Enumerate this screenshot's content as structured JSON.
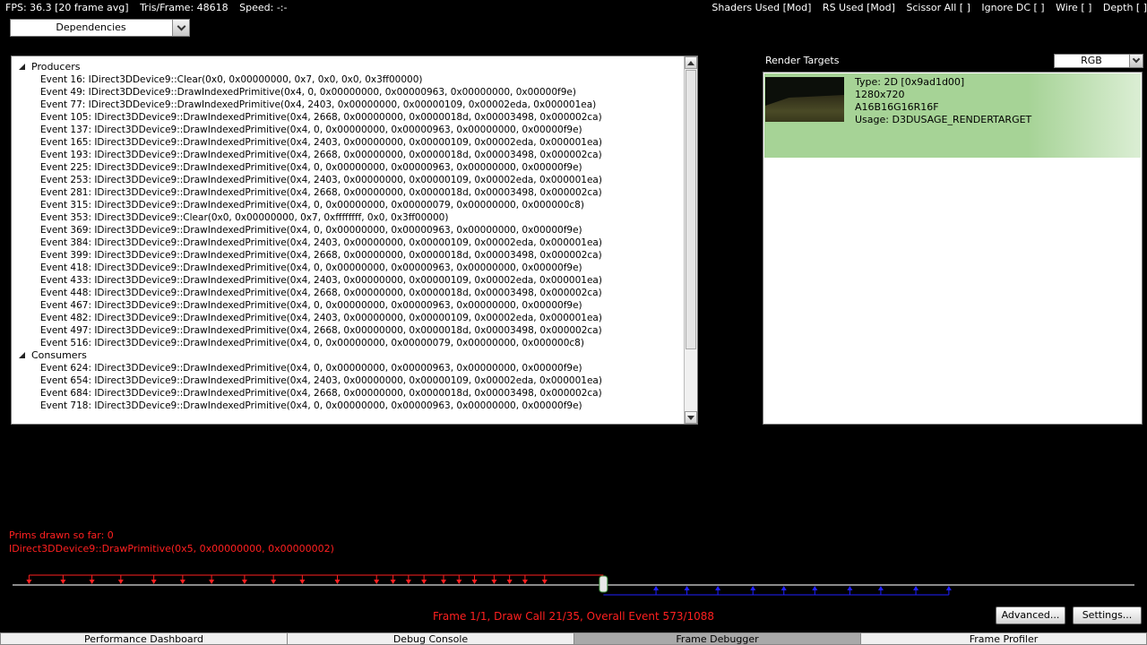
{
  "hud": {
    "fps": "FPS: 36.3 [20 frame avg]",
    "tris": "Tris/Frame:  48618",
    "speed": "Speed:  -:-",
    "toggles": [
      "Shaders Used [Mod]",
      "RS Used [Mod]",
      "Scissor All [ ]",
      "Ignore DC [ ]",
      "Wire [ ]",
      "Depth [ ]"
    ]
  },
  "view_selector": {
    "selected": "Dependencies"
  },
  "dependencies": {
    "producers_label": "Producers",
    "producers": [
      "Event 16: IDirect3DDevice9::Clear(0x0, 0x00000000, 0x7, 0x0, 0x0, 0x3ff00000)",
      "Event 49: IDirect3DDevice9::DrawIndexedPrimitive(0x4, 0, 0x00000000, 0x00000963, 0x00000000, 0x00000f9e)",
      "Event 77: IDirect3DDevice9::DrawIndexedPrimitive(0x4, 2403, 0x00000000, 0x00000109, 0x00002eda, 0x000001ea)",
      "Event 105: IDirect3DDevice9::DrawIndexedPrimitive(0x4, 2668, 0x00000000, 0x0000018d, 0x00003498, 0x000002ca)",
      "Event 137: IDirect3DDevice9::DrawIndexedPrimitive(0x4, 0, 0x00000000, 0x00000963, 0x00000000, 0x00000f9e)",
      "Event 165: IDirect3DDevice9::DrawIndexedPrimitive(0x4, 2403, 0x00000000, 0x00000109, 0x00002eda, 0x000001ea)",
      "Event 193: IDirect3DDevice9::DrawIndexedPrimitive(0x4, 2668, 0x00000000, 0x0000018d, 0x00003498, 0x000002ca)",
      "Event 225: IDirect3DDevice9::DrawIndexedPrimitive(0x4, 0, 0x00000000, 0x00000963, 0x00000000, 0x00000f9e)",
      "Event 253: IDirect3DDevice9::DrawIndexedPrimitive(0x4, 2403, 0x00000000, 0x00000109, 0x00002eda, 0x000001ea)",
      "Event 281: IDirect3DDevice9::DrawIndexedPrimitive(0x4, 2668, 0x00000000, 0x0000018d, 0x00003498, 0x000002ca)",
      "Event 315: IDirect3DDevice9::DrawIndexedPrimitive(0x4, 0, 0x00000000, 0x00000079, 0x00000000, 0x000000c8)",
      "Event 353: IDirect3DDevice9::Clear(0x0, 0x00000000, 0x7, 0xffffffff, 0x0, 0x3ff00000)",
      "Event 369: IDirect3DDevice9::DrawIndexedPrimitive(0x4, 0, 0x00000000, 0x00000963, 0x00000000, 0x00000f9e)",
      "Event 384: IDirect3DDevice9::DrawIndexedPrimitive(0x4, 2403, 0x00000000, 0x00000109, 0x00002eda, 0x000001ea)",
      "Event 399: IDirect3DDevice9::DrawIndexedPrimitive(0x4, 2668, 0x00000000, 0x0000018d, 0x00003498, 0x000002ca)",
      "Event 418: IDirect3DDevice9::DrawIndexedPrimitive(0x4, 0, 0x00000000, 0x00000963, 0x00000000, 0x00000f9e)",
      "Event 433: IDirect3DDevice9::DrawIndexedPrimitive(0x4, 2403, 0x00000000, 0x00000109, 0x00002eda, 0x000001ea)",
      "Event 448: IDirect3DDevice9::DrawIndexedPrimitive(0x4, 2668, 0x00000000, 0x0000018d, 0x00003498, 0x000002ca)",
      "Event 467: IDirect3DDevice9::DrawIndexedPrimitive(0x4, 0, 0x00000000, 0x00000963, 0x00000000, 0x00000f9e)",
      "Event 482: IDirect3DDevice9::DrawIndexedPrimitive(0x4, 2403, 0x00000000, 0x00000109, 0x00002eda, 0x000001ea)",
      "Event 497: IDirect3DDevice9::DrawIndexedPrimitive(0x4, 2668, 0x00000000, 0x0000018d, 0x00003498, 0x000002ca)",
      "Event 516: IDirect3DDevice9::DrawIndexedPrimitive(0x4, 0, 0x00000000, 0x00000079, 0x00000000, 0x000000c8)"
    ],
    "consumers_label": "Consumers",
    "consumers": [
      "Event 624: IDirect3DDevice9::DrawIndexedPrimitive(0x4, 0, 0x00000000, 0x00000963, 0x00000000, 0x00000f9e)",
      "Event 654: IDirect3DDevice9::DrawIndexedPrimitive(0x4, 2403, 0x00000000, 0x00000109, 0x00002eda, 0x000001ea)",
      "Event 684: IDirect3DDevice9::DrawIndexedPrimitive(0x4, 2668, 0x00000000, 0x0000018d, 0x00003498, 0x000002ca)",
      "Event 718: IDirect3DDevice9::DrawIndexedPrimitive(0x4, 0, 0x00000000, 0x00000963, 0x00000000, 0x00000f9e)"
    ]
  },
  "render_targets": {
    "title": "Render Targets",
    "channel": "RGB",
    "items": [
      {
        "type": "Type: 2D [0x9ad1d00]",
        "size": "1280x720",
        "format": "A16B16G16R16F",
        "usage": "Usage: D3DUSAGE_RENDERTARGET"
      }
    ]
  },
  "status": {
    "prims": "Prims drawn so far: 0",
    "current_call": "IDirect3DDevice9::DrawPrimitive(0x5, 0x00000000, 0x00000002)",
    "frame": "Frame 1/1, Draw Call 21/35, Overall Event 573/1088"
  },
  "timeline": {
    "total_events": 1088,
    "current_event": 573,
    "producer_events": [
      16,
      49,
      77,
      105,
      137,
      165,
      193,
      225,
      253,
      281,
      315,
      353,
      369,
      384,
      399,
      418,
      433,
      448,
      467,
      482,
      497,
      516
    ],
    "consumer_events": [
      624,
      654,
      684,
      718,
      748,
      778,
      812,
      842,
      876,
      908
    ],
    "colors": {
      "producer": "#ff2020",
      "consumer": "#2020ff",
      "track": "#8a8a8a"
    }
  },
  "buttons": {
    "advanced": "Advanced...",
    "settings": "Settings..."
  },
  "tabs": [
    {
      "label": "Performance Dashboard",
      "active": false
    },
    {
      "label": "Debug Console",
      "active": false
    },
    {
      "label": "Frame Debugger",
      "active": true
    },
    {
      "label": "Frame Profiler",
      "active": false
    }
  ]
}
